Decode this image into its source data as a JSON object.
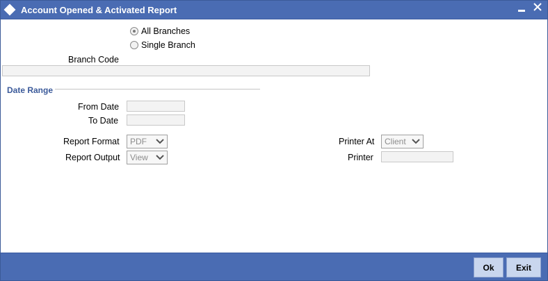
{
  "window": {
    "title": "Account Opened & Activated Report",
    "minimize_glyph": "‗",
    "close_glyph": "✕"
  },
  "branch_selection": {
    "all_branches_label": "All Branches",
    "single_branch_label": "Single Branch",
    "selected": "All Branches",
    "branch_code_label": "Branch Code",
    "branch_code_value": ""
  },
  "date_range": {
    "section_title": "Date Range",
    "from_date_label": "From Date",
    "from_date_value": "",
    "to_date_label": "To Date",
    "to_date_value": ""
  },
  "report": {
    "format_label": "Report Format",
    "format_value": "PDF",
    "output_label": "Report Output",
    "output_value": "View",
    "printer_at_label": "Printer At",
    "printer_at_value": "Client",
    "printer_label": "Printer",
    "printer_value": ""
  },
  "footer": {
    "ok_label": "Ok",
    "exit_label": "Exit"
  },
  "colors": {
    "titlebar": "#4a6cb3",
    "footer": "#4a6cb3",
    "section_title": "#3b5a9a",
    "button_bg": "#c9d6ee"
  }
}
